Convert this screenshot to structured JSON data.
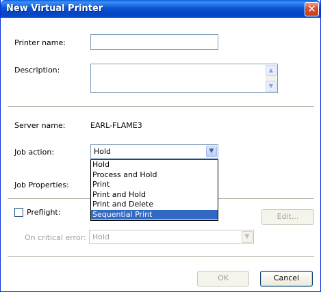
{
  "window": {
    "title": "New Virtual Printer",
    "close_glyph": "✕"
  },
  "form": {
    "printer_name_label": "Printer name:",
    "printer_name_value": "",
    "description_label": "Description:",
    "description_value": "",
    "server_name_label": "Server name:",
    "server_name_value": "EARL-FLAME3",
    "job_action_label": "Job action:",
    "job_action_value": "Hold",
    "job_properties_label": "Job Properties:",
    "job_action_options": [
      "Hold",
      "Process and Hold",
      "Print",
      "Print and Hold",
      "Print and Delete",
      "Sequential Print"
    ],
    "job_action_highlighted": "Sequential Print",
    "preflight_label": "Preflight:",
    "preflight_checked": false,
    "edit_button": "Edit...",
    "critical_error_label": "On critical error:",
    "critical_error_value": "Hold"
  },
  "footer": {
    "ok_label": "OK",
    "cancel_label": "Cancel"
  },
  "icons": {
    "scroll_up": "scroll-up-icon",
    "scroll_down": "scroll-down-icon",
    "dropdown": "chevron-down-icon",
    "close": "close-icon"
  },
  "colors": {
    "titlebar": "#0a55d6",
    "selection": "#316ac5",
    "close": "#d64c2b"
  }
}
